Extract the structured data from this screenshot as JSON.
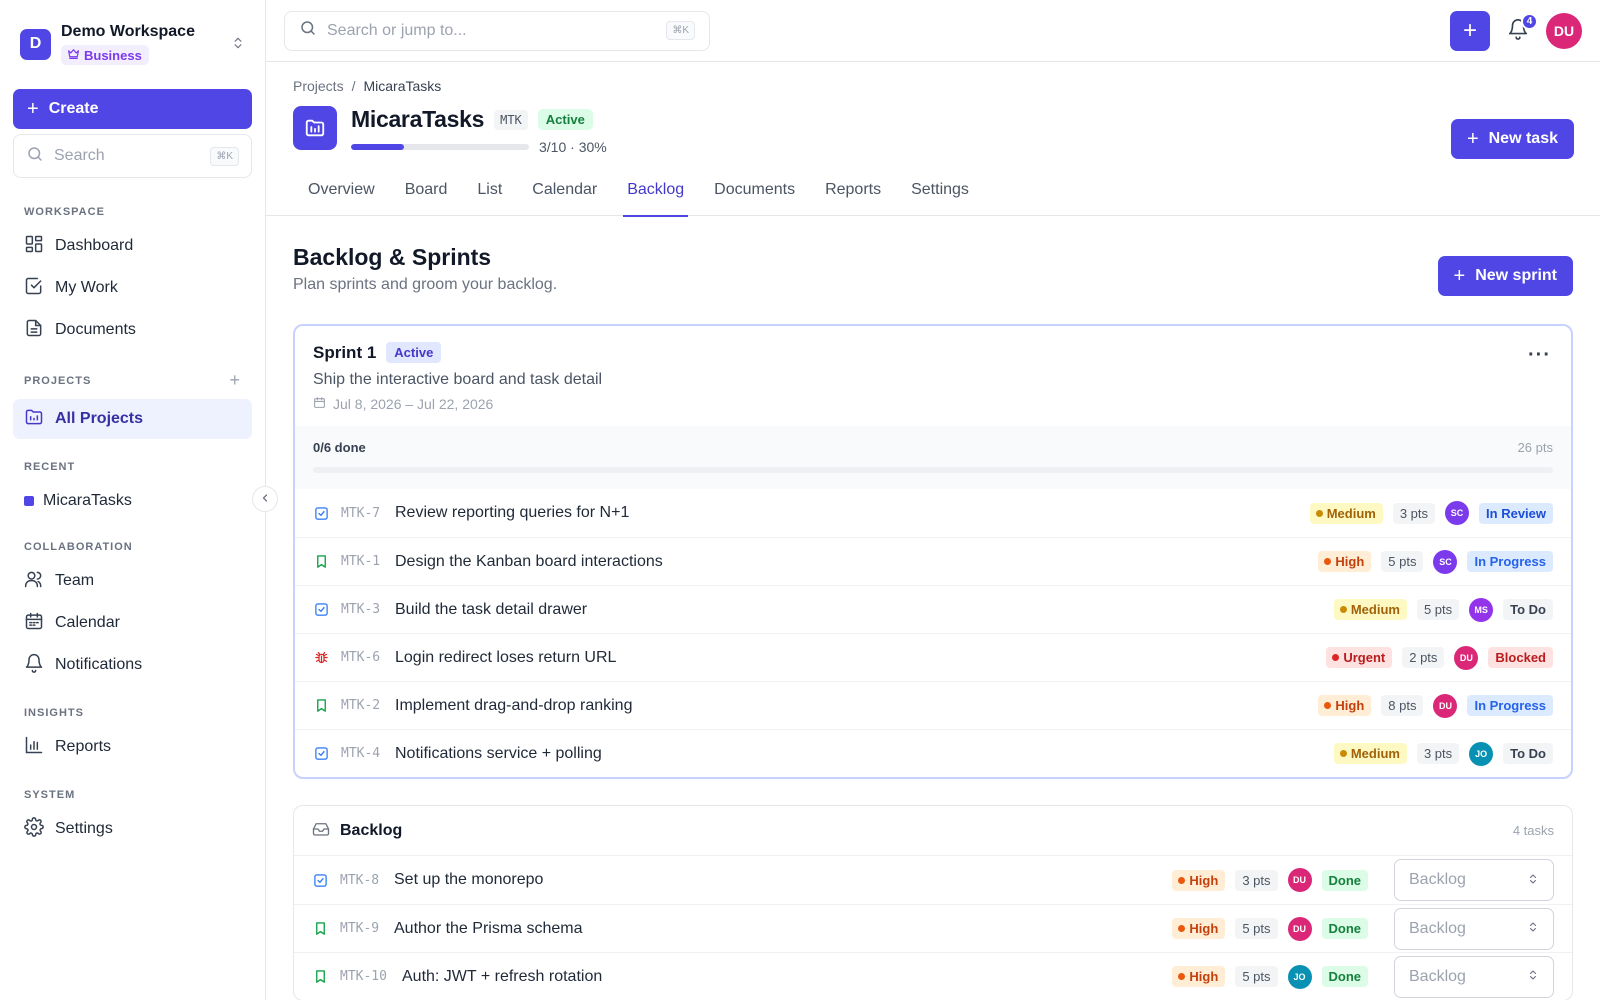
{
  "workspace": {
    "initial": "D",
    "name": "Demo Workspace",
    "plan": "Business"
  },
  "sidebar": {
    "create_label": "Create",
    "search_placeholder": "Search",
    "search_kbd": "⌘K",
    "sections": {
      "workspace": "WORKSPACE",
      "projects": "PROJECTS",
      "recent": "RECENT",
      "collaboration": "COLLABORATION",
      "insights": "INSIGHTS",
      "system": "SYSTEM"
    },
    "items": {
      "dashboard": "Dashboard",
      "my_work": "My Work",
      "documents": "Documents",
      "all_projects": "All Projects",
      "recent_project": "MicaraTasks",
      "team": "Team",
      "calendar": "Calendar",
      "notifications": "Notifications",
      "reports": "Reports",
      "settings": "Settings"
    }
  },
  "topbar": {
    "search_placeholder": "Search or jump to...",
    "search_kbd": "⌘K",
    "notifications_count": "4",
    "user_initials": "DU"
  },
  "project": {
    "breadcrumb_root": "Projects",
    "breadcrumb_sep": "/",
    "breadcrumb_current": "MicaraTasks",
    "name": "MicaraTasks",
    "key": "MTK",
    "status": "Active",
    "progress_fraction": 0.3,
    "progress_text": "3/10 · 30%",
    "new_task_label": "New task",
    "tabs": [
      "Overview",
      "Board",
      "List",
      "Calendar",
      "Backlog",
      "Documents",
      "Reports",
      "Settings"
    ],
    "active_tab": "Backlog"
  },
  "backlog_page": {
    "title": "Backlog & Sprints",
    "subtitle": "Plan sprints and groom your backlog.",
    "new_sprint_label": "New sprint"
  },
  "sprint": {
    "name": "Sprint 1",
    "status": "Active",
    "goal": "Ship the interactive board and task detail",
    "dates": "Jul 8, 2026 – Jul 22, 2026",
    "more": "···",
    "done_text": "0/6 done",
    "points_text": "26 pts",
    "done_fraction": 0,
    "tasks": [
      {
        "type": "task",
        "key": "MTK-7",
        "title": "Review reporting queries for N+1",
        "priority": "Medium",
        "priority_class": "medium",
        "points": "3 pts",
        "assignee": "SC",
        "assignee_color": "#7c3aed",
        "status": "In Review",
        "status_class": "review"
      },
      {
        "type": "story",
        "key": "MTK-1",
        "title": "Design the Kanban board interactions",
        "priority": "High",
        "priority_class": "high",
        "points": "5 pts",
        "assignee": "SC",
        "assignee_color": "#7c3aed",
        "status": "In Progress",
        "status_class": "progress"
      },
      {
        "type": "task",
        "key": "MTK-3",
        "title": "Build the task detail drawer",
        "priority": "Medium",
        "priority_class": "medium",
        "points": "5 pts",
        "assignee": "MS",
        "assignee_color": "#9333ea",
        "status": "To Do",
        "status_class": "todo"
      },
      {
        "type": "bug",
        "key": "MTK-6",
        "title": "Login redirect loses return URL",
        "priority": "Urgent",
        "priority_class": "urgent",
        "points": "2 pts",
        "assignee": "DU",
        "assignee_color": "#db2777",
        "status": "Blocked",
        "status_class": "blocked"
      },
      {
        "type": "story",
        "key": "MTK-2",
        "title": "Implement drag-and-drop ranking",
        "priority": "High",
        "priority_class": "high",
        "points": "8 pts",
        "assignee": "DU",
        "assignee_color": "#db2777",
        "status": "In Progress",
        "status_class": "progress"
      },
      {
        "type": "task",
        "key": "MTK-4",
        "title": "Notifications service + polling",
        "priority": "Medium",
        "priority_class": "medium",
        "points": "3 pts",
        "assignee": "JO",
        "assignee_color": "#0891b2",
        "status": "To Do",
        "status_class": "todo"
      }
    ]
  },
  "backlog": {
    "title": "Backlog",
    "count_text": "4 tasks",
    "tasks": [
      {
        "type": "task",
        "key": "MTK-8",
        "title": "Set up the monorepo",
        "priority": "High",
        "priority_class": "high",
        "points": "3 pts",
        "assignee": "DU",
        "assignee_color": "#db2777",
        "status": "Done",
        "status_class": "done",
        "sprint_select": "Backlog"
      },
      {
        "type": "story",
        "key": "MTK-9",
        "title": "Author the Prisma schema",
        "priority": "High",
        "priority_class": "high",
        "points": "5 pts",
        "assignee": "DU",
        "assignee_color": "#db2777",
        "status": "Done",
        "status_class": "done",
        "sprint_select": "Backlog"
      },
      {
        "type": "story",
        "key": "MTK-10",
        "title": "Auth: JWT + refresh rotation",
        "priority": "High",
        "priority_class": "high",
        "points": "5 pts",
        "assignee": "JO",
        "assignee_color": "#0891b2",
        "status": "Done",
        "status_class": "done",
        "sprint_select": "Backlog"
      }
    ]
  },
  "colors": {
    "accent": "#4f46e5",
    "accent_light": "#eef2ff"
  }
}
